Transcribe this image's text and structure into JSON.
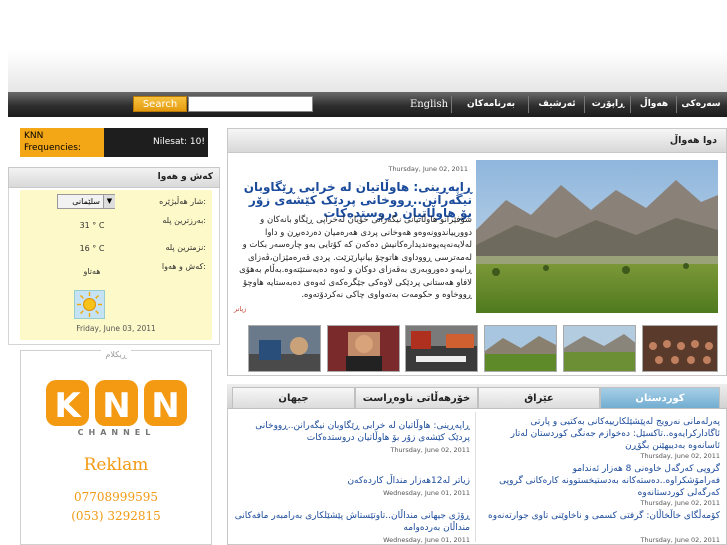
{
  "nav": {
    "search_button": "Search",
    "search_placeholder": "",
    "items": [
      "سەرەکی",
      "هەواڵ",
      "ڕاپۆرت",
      "ئەرشیف",
      "بەرنامەکان",
      "English"
    ]
  },
  "frequency": {
    "label": "KNN Frequencies:",
    "nilesat": "Nilesat: 10!"
  },
  "weather": {
    "title": "کەش و هەوا",
    "city_label": "شار هەڵبژێرە:",
    "city_value": "سلێمانی",
    "max_label": "بەرزترین پلە:",
    "max_value": "31 ° C",
    "min_label": "نزمترین پلە:",
    "min_value": "16 ° C",
    "condition_label": "کەش و هەوا:",
    "condition_value": "هەتاو",
    "date": "Friday, June 03, 2011",
    "icon": "sun-icon"
  },
  "ad": {
    "label": "ڕیکلام",
    "logo": "KNN",
    "channel": "CHANNEL",
    "reklam": "Reklam",
    "phone1": "07708999595",
    "phone2": "(053) 3292815"
  },
  "latest": {
    "title": "دوا هەواڵ",
    "featured_date": "Thursday, June 02, 2011",
    "featured_title": "ڕاپەڕینی: هاوڵاتیان لە خرابی ڕێگاوبان نیگەرانن..ڕووخانی پردێک کێشەی زۆر بۆ هاوڵاتیان دروستدەکات",
    "featured_summary": "شۆفێرانو هاوڵاتیانی نیگەرانی خۆیان لەخراپی ڕێگاو بانەکان و دوورییاندوونەوەو هەوخانی پردی هەرەمیان دەردەبڕن و داوا لەلایەنەپەیوەندیدارەکانیش دەکەن کە کۆتایی بەو چارەسەر بکات و لەمەترسی ڕووداوی هاتوچۆ بیانپارێزێت. پردی قەرەمێزان،ڤەزای ڕانیەو دەوروبەری بەقەزای دوکان و ئەوە دەبەستێتەوە.بەڵام بەهۆی لافاو هەستانی پردێکی لاوەکی جێگرەکەی ئەوەی دەبەستایە هاوچۆ ڕووخاوە و حکومەت بەتەواوی چاکی نەکردۆتەوە.",
    "featured_more": "زیاتر"
  },
  "tabs": [
    {
      "label": "کوردستان",
      "active": true
    },
    {
      "label": "عێراق",
      "active": false
    },
    {
      "label": "خۆرهەڵاتی ناوەڕاست",
      "active": false
    },
    {
      "label": "جیهان",
      "active": false
    }
  ],
  "news_right": [
    {
      "title": "پەرلەمانی نەرویج لەپێشێلکارییەکانی بەکتیی و پارتی ئاگادارکرایەوە..تاکسێل: دەخوازم جەنگی کوردستان لەتار ئاسانەوە بەدیبھێنن بگۆڕن",
      "date": "Thursday, June 02, 2011"
    },
    {
      "title": "گروپی کەرگەل خاوەنی 8 هەزار ئەندامو فەرامۆشکراوە..دەستەکانە بەدستیخستوونە کارەکانی گروپی کەرگەلی کوردستانەوە",
      "date": "Thursday, June 02, 2011"
    },
    {
      "title": "کۆمەڵگای خاڵخاڵان: گرفتی کسمی و ناخاوێنی تاوی جوارتەنەوە",
      "date": "Thursday, June 02, 2011"
    }
  ],
  "news_left": [
    {
      "title": "ڕاپەڕینی: هاوڵاتیان لە خرابی ڕێگاوبان نیگەرانن..ڕووخانی پردێک کێشەی زۆر بۆ هاوڵاتیان دروستدەکات",
      "date": "Thursday, June 02, 2011"
    },
    {
      "title": "زیاتر لە12هەزار منداڵ کاردەکەن",
      "date": "Wednesday, June 01, 2011"
    },
    {
      "title": "ڕۆژی جیهانی منداڵان..تاوتێستاش پێشێلکاری بەرامبەر مافەکانی منداڵان بەردەوامە",
      "date": "Wednesday, June 01, 2011"
    }
  ],
  "colors": {
    "accent": "#f4a716",
    "link": "#1a4a9a",
    "tab_active": "#72add1"
  }
}
